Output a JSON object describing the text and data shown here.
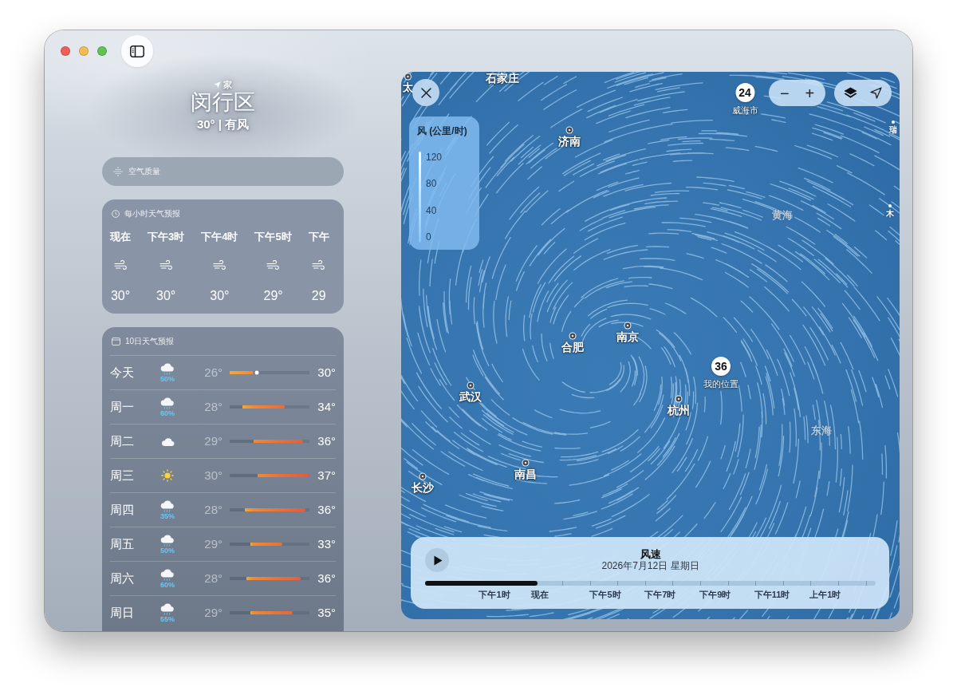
{
  "headline": {
    "label": "家",
    "place": "闵行区",
    "summary": "30° | 有风"
  },
  "air_quality": {
    "title": "空气质量"
  },
  "hourly": {
    "title": "每小时天气预报",
    "hours": [
      {
        "time": "现在",
        "temperature": "30°"
      },
      {
        "time": "下午3时",
        "temperature": "30°"
      },
      {
        "time": "下午4时",
        "temperature": "30°"
      },
      {
        "time": "下午5时",
        "temperature": "29°"
      },
      {
        "time": "下午",
        "temperature": "29"
      }
    ]
  },
  "daily": {
    "title": "10日天气预报",
    "days": [
      {
        "day": "今天",
        "kind": "rain",
        "chance": "50%",
        "low": "26°",
        "high": "30°",
        "bar": {
          "start": {
            "level": 0
          },
          "end": {
            "level": 0.3
          }
        },
        "now": {
          "level": 0.34
        }
      },
      {
        "day": "周一",
        "kind": "rain",
        "chance": "60%",
        "low": "28°",
        "high": "34°",
        "bar": {
          "start": {
            "level": 0.16
          },
          "end": {
            "level": 0.69
          }
        }
      },
      {
        "day": "周二",
        "kind": "cloud",
        "low": "29°",
        "high": "36°",
        "bar": {
          "start": {
            "level": 0.3
          },
          "end": {
            "level": 0.92
          }
        }
      },
      {
        "day": "周三",
        "kind": "sun",
        "low": "30°",
        "high": "37°",
        "bar": {
          "start": {
            "level": 0.35
          },
          "end": {
            "level": 1
          }
        }
      },
      {
        "day": "周四",
        "kind": "rain",
        "chance": "35%",
        "low": "28°",
        "high": "36°",
        "bar": {
          "start": {
            "level": 0.19
          },
          "end": {
            "level": 0.95
          }
        }
      },
      {
        "day": "周五",
        "kind": "rain",
        "chance": "50%",
        "low": "29°",
        "high": "33°",
        "bar": {
          "start": {
            "level": 0.26
          },
          "end": {
            "level": 0.66
          }
        }
      },
      {
        "day": "周六",
        "kind": "rain",
        "chance": "60%",
        "low": "28°",
        "high": "36°",
        "bar": {
          "start": {
            "level": 0.21
          },
          "end": {
            "level": 0.89
          }
        }
      },
      {
        "day": "周日",
        "kind": "rain",
        "chance": "55%",
        "low": "29°",
        "high": "35°",
        "bar": {
          "start": {
            "level": 0.26
          },
          "end": {
            "level": 0.79
          }
        }
      }
    ]
  },
  "map": {
    "legend": {
      "title": "风 (公里/时)",
      "scale": [
        "120",
        "80",
        "40",
        "0"
      ]
    },
    "zoom": {
      "out": "−",
      "in": "+"
    },
    "places": [
      {
        "kind": "label",
        "name": "石家庄"
      },
      {
        "kind": "city",
        "name": "太"
      },
      {
        "kind": "city",
        "name": "济南"
      },
      {
        "kind": "minor",
        "name": "瑞"
      },
      {
        "kind": "sea",
        "name": "黄海"
      },
      {
        "kind": "minor",
        "name": "木"
      },
      {
        "kind": "city",
        "name": "南京"
      },
      {
        "kind": "city",
        "name": "合肥"
      },
      {
        "kind": "city",
        "name": "武汉"
      },
      {
        "kind": "city",
        "name": "杭州"
      },
      {
        "kind": "sea",
        "name": "东海"
      },
      {
        "kind": "city",
        "name": "南昌"
      },
      {
        "kind": "city",
        "name": "长沙"
      }
    ],
    "pins": [
      {
        "value": "24",
        "label": "威海市"
      },
      {
        "value": "36",
        "label": "我的位置"
      }
    ]
  },
  "timeline": {
    "title": "风速",
    "date": "2026年7月12日 星期日",
    "level": 0.25,
    "labels": [
      "下午1时",
      "现在",
      "下午5时",
      "下午7时",
      "下午9时",
      "下午11时",
      "上午1时"
    ]
  }
}
